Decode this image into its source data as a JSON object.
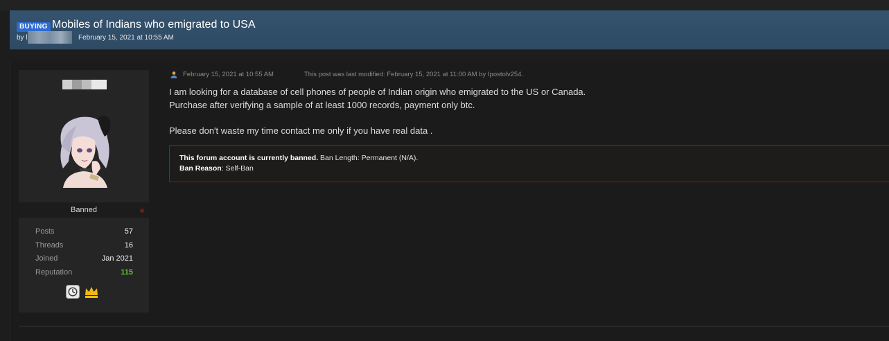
{
  "thread": {
    "prefix": "BUYING",
    "title": "Mobiles of Indians who emigrated to USA",
    "by_label": "by l",
    "date": "February 15, 2021 at 10:55 AM"
  },
  "user": {
    "status": "Banned",
    "stats": [
      {
        "label": "Posts",
        "value": "57"
      },
      {
        "label": "Threads",
        "value": "16"
      },
      {
        "label": "Joined",
        "value": "Jan 2021"
      },
      {
        "label": "Reputation",
        "value": "115"
      }
    ],
    "awards": [
      "clock-award-icon",
      "crown-award-icon"
    ]
  },
  "post": {
    "date": "February 15, 2021 at 10:55 AM",
    "modified_note": "This post was last modified: February 15, 2021 at 11:00 AM by Ipostolv254.",
    "lines": [
      "I am looking for a database of cell phones of people of Indian origin who emigrated to the US or Canada.",
      "Purchase after verifying a sample of at least 1000 records, payment only btc.",
      "",
      "Please don't waste my time contact me only if you have real data ."
    ],
    "ban": {
      "status_bold": "This forum account is currently banned.",
      "length_text": " Ban Length: Permanent (N/A).",
      "reason_label": "Ban Reason",
      "reason_text": ": Self-Ban"
    }
  },
  "colors": {
    "header_bg": "#35536f",
    "prefix_badge": "#2d6bd0",
    "reputation": "#5fc12f",
    "ban_border": "#7a2622"
  }
}
